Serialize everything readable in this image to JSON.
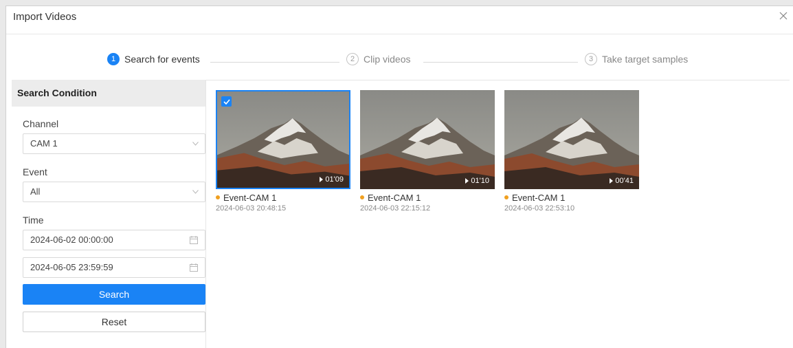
{
  "dialog": {
    "title": "Import Videos"
  },
  "steps": [
    {
      "number": "1",
      "label": "Search for events",
      "active": true
    },
    {
      "number": "2",
      "label": "Clip videos",
      "active": false
    },
    {
      "number": "3",
      "label": "Take target samples",
      "active": false
    }
  ],
  "sidebar": {
    "header": "Search Condition",
    "channel_label": "Channel",
    "channel_value": "CAM 1",
    "event_label": "Event",
    "event_value": "All",
    "time_label": "Time",
    "start_time": "2024-06-02 00:00:00",
    "end_time": "2024-06-05 23:59:59",
    "search_button": "Search",
    "reset_button": "Reset"
  },
  "results": [
    {
      "name": "Event-CAM 1",
      "time": "2024-06-03 20:48:15",
      "duration": "01'09",
      "selected": true
    },
    {
      "name": "Event-CAM 1",
      "time": "2024-06-03 22:15:12",
      "duration": "01'10",
      "selected": false
    },
    {
      "name": "Event-CAM 1",
      "time": "2024-06-03 22:53:10",
      "duration": "00'41",
      "selected": false
    }
  ],
  "colors": {
    "accent": "#1a83f5",
    "event_dot": "#f0a020"
  },
  "icons": {
    "close": "close-icon",
    "dropdown": "chevron-down-icon",
    "date": "calendar-icon",
    "check": "checkmark-icon",
    "play": "play-icon"
  }
}
